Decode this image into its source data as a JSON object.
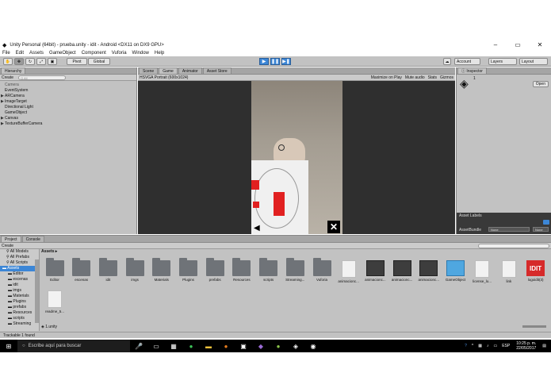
{
  "window": {
    "title": "Unity Personal (64bit) - prueba.unity - idit - Android <DX11 on DX9 GPU>",
    "min_label": "–",
    "max_label": "▭",
    "close_label": "✕"
  },
  "menu": [
    "File",
    "Edit",
    "Assets",
    "GameObject",
    "Component",
    "Vuforia",
    "Window",
    "Help"
  ],
  "toolbar": {
    "pivot_label": "Pivot",
    "global_label": "Global",
    "play_label": "▶",
    "pause_label": "❚❚",
    "step_label": "▶❚",
    "account_label": "Account",
    "layers_label": "Layers",
    "layout_label": "Layout"
  },
  "hierarchy": {
    "tab_label": "Hierarchy",
    "create_label": "Create",
    "search_placeholder": "Q All",
    "items": [
      {
        "label": "Camera",
        "expand": "",
        "grey": true
      },
      {
        "label": "EventSystem",
        "expand": "",
        "grey": false
      },
      {
        "label": "ARCamera",
        "expand": "▶",
        "grey": false
      },
      {
        "label": "ImageTarget",
        "expand": "▶",
        "grey": false
      },
      {
        "label": "Directional Light",
        "expand": "",
        "grey": false
      },
      {
        "label": "GameObject",
        "expand": "",
        "grey": false
      },
      {
        "label": "Canvas",
        "expand": "▶",
        "grey": false
      },
      {
        "label": "TextureBufferCamera",
        "expand": "▶",
        "grey": false
      }
    ]
  },
  "center_tabs": [
    "Scene",
    "Game",
    "Animator",
    "Asset Store"
  ],
  "game": {
    "resolution_label": "HSVGA Portrait (600x1024)",
    "maximize_label": "Maximize on Play",
    "mute_label": "Mute audio",
    "stats_label": "Stats",
    "gizmos_label": "Gizmos",
    "back_arrow": "◀",
    "close_x": "✕"
  },
  "inspector": {
    "tab_label": "Inspector",
    "count": "1",
    "open_label": "Open",
    "asset_labels_title": "Asset Labels",
    "asset_bundle_label": "AssetBundle",
    "none_label": "None",
    "none_label_2": "None"
  },
  "project": {
    "tab_label": "Project",
    "console_tab_label": "Console",
    "create_label": "Create",
    "sidebar": [
      {
        "label": "All Models",
        "kind": "search"
      },
      {
        "label": "All Prefabs",
        "kind": "search"
      },
      {
        "label": "All Scripts",
        "kind": "search"
      },
      {
        "label": "Assets",
        "kind": "root"
      },
      {
        "label": "Editor",
        "kind": "folder"
      },
      {
        "label": "escenas",
        "kind": "folder"
      },
      {
        "label": "idit",
        "kind": "folder"
      },
      {
        "label": "imgs",
        "kind": "folder"
      },
      {
        "label": "Materials",
        "kind": "folder"
      },
      {
        "label": "Plugins",
        "kind": "folder"
      },
      {
        "label": "prefabs",
        "kind": "folder"
      },
      {
        "label": "Resources",
        "kind": "folder"
      },
      {
        "label": "scripts",
        "kind": "folder"
      },
      {
        "label": "Streaming",
        "kind": "folder"
      }
    ],
    "breadcrumb": "Assets ▸",
    "assets_row1": [
      {
        "label": "Editor",
        "type": "folder"
      },
      {
        "label": "escenas",
        "type": "folder"
      },
      {
        "label": "idit",
        "type": "folder"
      },
      {
        "label": "imgs",
        "type": "folder"
      },
      {
        "label": "Materials",
        "type": "folder"
      },
      {
        "label": "Plugins",
        "type": "folder"
      },
      {
        "label": "prefabs",
        "type": "folder"
      },
      {
        "label": "Resources",
        "type": "folder"
      },
      {
        "label": "scripts",
        "type": "folder"
      },
      {
        "label": "Streaming...",
        "type": "folder"
      },
      {
        "label": "Vuforia",
        "type": "folder"
      },
      {
        "label": "animacionc...",
        "type": "doc"
      },
      {
        "label": "animacionc...",
        "type": "anim"
      },
      {
        "label": "animacionc...",
        "type": "anim"
      },
      {
        "label": "animacionc...",
        "type": "anim"
      },
      {
        "label": "GameObject",
        "type": "cube"
      },
      {
        "label": "license_lo...",
        "type": "doc"
      },
      {
        "label": "link",
        "type": "doc"
      },
      {
        "label": "logoidit(3)",
        "type": "idit"
      }
    ],
    "assets_row2": [
      {
        "label": "readme_5...",
        "type": "doc"
      }
    ],
    "footer_file": "1.unity"
  },
  "statusbar": {
    "message": "Trackable 1 found"
  },
  "taskbar": {
    "search_placeholder": "Escribe aquí para buscar",
    "lang": "ESP",
    "time": "10:25 p. m.",
    "date": "22/05/2017"
  }
}
